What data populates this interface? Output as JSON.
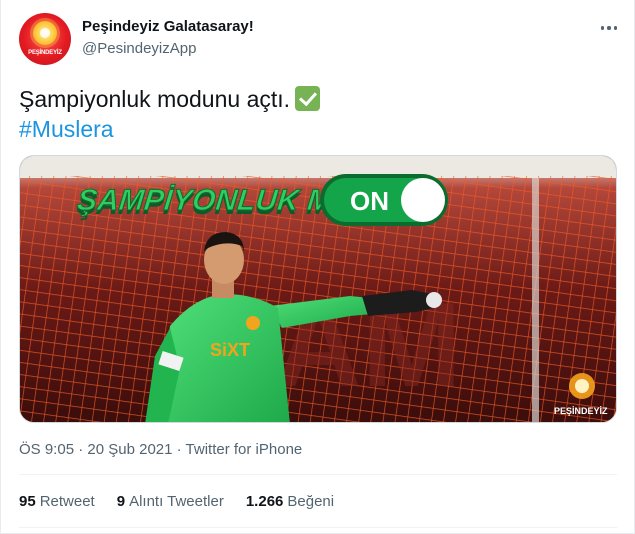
{
  "tweet": {
    "display_name": "Peşindeyiz Galatasaray!",
    "handle": "@PesindeyizApp",
    "text": "Şampiyonluk modunu açtı.",
    "text_emoji": "check-mark-button",
    "hashtag": "#Muslera",
    "avatar_label_a": "PEŞİNDEYİZ",
    "avatar_label_b": "",
    "time": "ÖS 9:05",
    "date": "20 Şub 2021",
    "separator": "·",
    "client": "Twitter for iPhone"
  },
  "media": {
    "banner_text": "ŞAMPİYONLUK MODU",
    "toggle_text": "ON",
    "watermark_text": "PEŞİNDEYİZ",
    "sponsor_text": "SiXT",
    "colors": {
      "background": "#5a1512",
      "net": "#f05a28",
      "jersey": "#2ec85b",
      "banner": "#1aa64a",
      "toggle": "#0f8f3f"
    }
  },
  "stats": [
    {
      "count": "95",
      "label": "Retweet"
    },
    {
      "count": "9",
      "label": "Alıntı Tweetler"
    },
    {
      "count": "1.266",
      "label": "Beğeni"
    }
  ],
  "colors": {
    "link": "#1b95e0",
    "secondary": "#536471",
    "primary_text": "#0f1419",
    "avatar_red": "#e31b23"
  }
}
